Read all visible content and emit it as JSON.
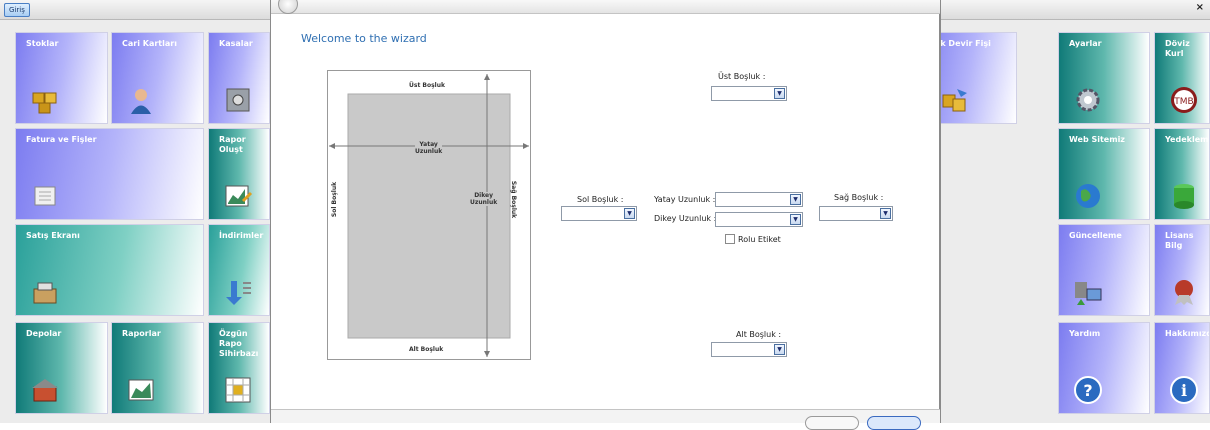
{
  "topbar": {
    "tab_label": "Giriş",
    "close": "×"
  },
  "tiles": {
    "stoklar": "Stoklar",
    "cari": "Cari Kartları",
    "kasalar": "Kasalar",
    "fatura": "Fatura ve Fişler",
    "rapor_olustur": "Rapor Oluşt",
    "satis": "Satış Ekranı",
    "indirimler": "İndirimler",
    "depolar": "Depolar",
    "raporlar": "Raporlar",
    "ozgun": "Özgün Rapo\nSihirbazı",
    "devir": "tok Devir Fişi",
    "ayarlar": "Ayarlar",
    "doviz": "Döviz Kurl",
    "web": "Web Sitemiz",
    "yedek": "Yedeklem",
    "guncelleme": "Güncelleme",
    "lisans": "Lisans Bilg",
    "yardim": "Yardım",
    "hakkimizda": "Hakkımızd"
  },
  "wizard": {
    "title": "Welcome to the wizard",
    "ust": "Üst Boşluk :",
    "sol": "Sol Boşluk :",
    "yatay": "Yatay Uzunluk :",
    "dikey": "Dikey Uzunluk :",
    "sag": "Sağ Boşluk :",
    "rolu": "Rolu Etiket",
    "alt": "Alt Boşluk :"
  },
  "diagram": {
    "ust": "Üst Boşluk",
    "alt": "Alt Boşluk",
    "sol": "Sol Boşluk",
    "sag": "Sağ Boşluk",
    "yatay": "Yatay\nUzunluk",
    "dikey": "Dikey\nUzunluk"
  }
}
